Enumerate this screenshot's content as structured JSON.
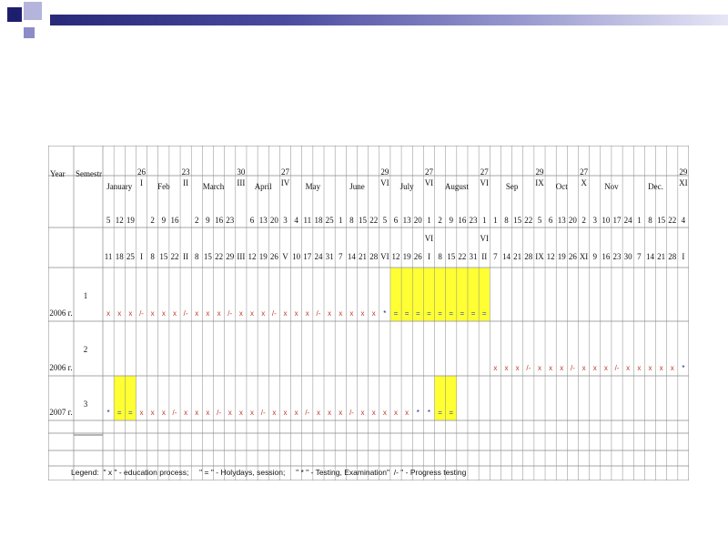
{
  "colors": {
    "deco_dark": "#1e1e6e",
    "deco_mid": "#4b4ba0",
    "deco_light": "#9a9ad0",
    "grid": "#8a8a8a",
    "highlight": "#ffff33",
    "x_mark": "#c0392b",
    "eq_mark": "#2c4fbf",
    "star_mark": "#1a237e"
  },
  "header": {
    "year": "Year",
    "semestr": "Semestr"
  },
  "months": [
    {
      "label": "January",
      "from": 0,
      "to": 2
    },
    {
      "label": "Feb",
      "from": 4,
      "to": 6
    },
    {
      "label": "March",
      "from": 8,
      "to": 11
    },
    {
      "label": "April",
      "from": 13,
      "to": 15
    },
    {
      "label": "May",
      "from": 17,
      "to": 20
    },
    {
      "label": "June",
      "from": 21,
      "to": 24
    },
    {
      "label": "July",
      "from": 26,
      "to": 28
    },
    {
      "label": "August",
      "from": 30,
      "to": 33
    },
    {
      "label": "Sep",
      "from": 35,
      "to": 38
    },
    {
      "label": "Oct",
      "from": 40,
      "to": 42
    },
    {
      "label": "Nov",
      "from": 44,
      "to": 47
    },
    {
      "label": "Dec.",
      "from": 48,
      "to": 51
    }
  ],
  "boundaries": [
    {
      "col": 3,
      "top1": "26",
      "top2": "I"
    },
    {
      "col": 7,
      "top1": "23",
      "top2": "II"
    },
    {
      "col": 12,
      "top1": "30",
      "top2": "III"
    },
    {
      "col": 16,
      "top1": "27",
      "top2": "IV"
    },
    {
      "col": 25,
      "top1": "29",
      "top2": "VI"
    },
    {
      "col": 29,
      "top1": "27",
      "top2": "VI"
    },
    {
      "col": 34,
      "top1": "27",
      "top2": "VI"
    },
    {
      "col": 39,
      "top1": "29",
      "top2": "IX"
    },
    {
      "col": 43,
      "top1": "27",
      "top2": "X"
    },
    {
      "col": 52,
      "top1": "29",
      "top2": "XI"
    }
  ],
  "week_start_row": [
    "5",
    "12",
    "19",
    "",
    "2",
    "9",
    "16",
    "",
    "2",
    "9",
    "16",
    "23",
    "",
    "6",
    "13",
    "20",
    "3",
    "4",
    "11",
    "18",
    "25",
    "1",
    "8",
    "15",
    "22",
    "5",
    "6",
    "13",
    "20",
    "1",
    "2",
    "9",
    "16",
    "23",
    "1",
    "1",
    "8",
    "15",
    "22",
    "5",
    "6",
    "13",
    "20",
    "2",
    "3",
    "10",
    "17",
    "24",
    "1",
    "8",
    "15",
    "22",
    "4"
  ],
  "week_mid_row": [
    "",
    "",
    "",
    "",
    "",
    "",
    "",
    "",
    "",
    "",
    "",
    "",
    "",
    "",
    "",
    "",
    "",
    "",
    "",
    "",
    "",
    "",
    "",
    "",
    "",
    "",
    "",
    "",
    "",
    "VI",
    "",
    "",
    "",
    "",
    "VI",
    "",
    "",
    "",
    "",
    "",
    "",
    "",
    "",
    "",
    "",
    "",
    "",
    "",
    "",
    "",
    "",
    "",
    ""
  ],
  "week_end_row": [
    "11",
    "18",
    "25",
    "I",
    "8",
    "15",
    "22",
    "II",
    "8",
    "15",
    "22",
    "29",
    "III",
    "12",
    "19",
    "26",
    "V",
    "10",
    "17",
    "24",
    "31",
    "7",
    "14",
    "21",
    "28",
    "VI",
    "12",
    "19",
    "26",
    "I",
    "8",
    "15",
    "22",
    "31",
    "II",
    "7",
    "14",
    "21",
    "28",
    "IX",
    "12",
    "19",
    "26",
    "XI",
    "9",
    "16",
    "23",
    "30",
    "7",
    "14",
    "21",
    "28",
    "I"
  ],
  "rows": [
    {
      "semester": "1",
      "year": "2006 г.",
      "marks": [
        "x",
        "x",
        "x",
        "/-",
        "x",
        "x",
        "x",
        "/-",
        "x",
        "x",
        "x",
        "/-",
        "x",
        "x",
        "x",
        "/-",
        "x",
        "x",
        "x",
        "/-",
        "x",
        "x",
        "x",
        "x",
        "x",
        "*",
        "=",
        "=",
        "=",
        "=",
        "=",
        "=",
        "=",
        "=",
        "=",
        "",
        "",
        "",
        "",
        "",
        "",
        "",
        "",
        "",
        "",
        "",
        "",
        "",
        "",
        "",
        "",
        "",
        ""
      ],
      "highlight_from": 26,
      "highlight_to": 34
    },
    {
      "semester": "2",
      "year": "2006 г.",
      "marks": [
        "",
        "",
        "",
        "",
        "",
        "",
        "",
        "",
        "",
        "",
        "",
        "",
        "",
        "",
        "",
        "",
        "",
        "",
        "",
        "",
        "",
        "",
        "",
        "",
        "",
        "",
        "",
        "",
        "",
        "",
        "",
        "",
        "",
        "",
        "",
        "x",
        "x",
        "x",
        "/-",
        "x",
        "x",
        "x",
        "/-",
        "x",
        "x",
        "x",
        "/-",
        "x",
        "x",
        "x",
        "x",
        "x",
        "*"
      ],
      "highlight_from": -1,
      "highlight_to": -1
    },
    {
      "semester": "3",
      "year": "2007 г.",
      "marks": [
        "*",
        "=",
        "=",
        "x",
        "x",
        "x",
        "/-",
        "x",
        "x",
        "x",
        "/-",
        "x",
        "x",
        "x",
        "/-",
        "x",
        "x",
        "x",
        "/-",
        "x",
        "x",
        "x",
        "/-",
        "x",
        "x",
        "x",
        "x",
        "x",
        "*",
        "*",
        "=",
        "=",
        "",
        "",
        "",
        "",
        "",
        "",
        "",
        "",
        "",
        "",
        "",
        "",
        "",
        "",
        "",
        "",
        "",
        "",
        "",
        "",
        ""
      ],
      "highlight_from": 1,
      "highlight_to": 2,
      "highlight2_from": 30,
      "highlight2_to": 31
    }
  ],
  "legend": "Legend:  \" x \" - education process;     \" = \" - Holydays, session;     \" * \" - Testing, Examination\"  /- \" - Progress testing"
}
